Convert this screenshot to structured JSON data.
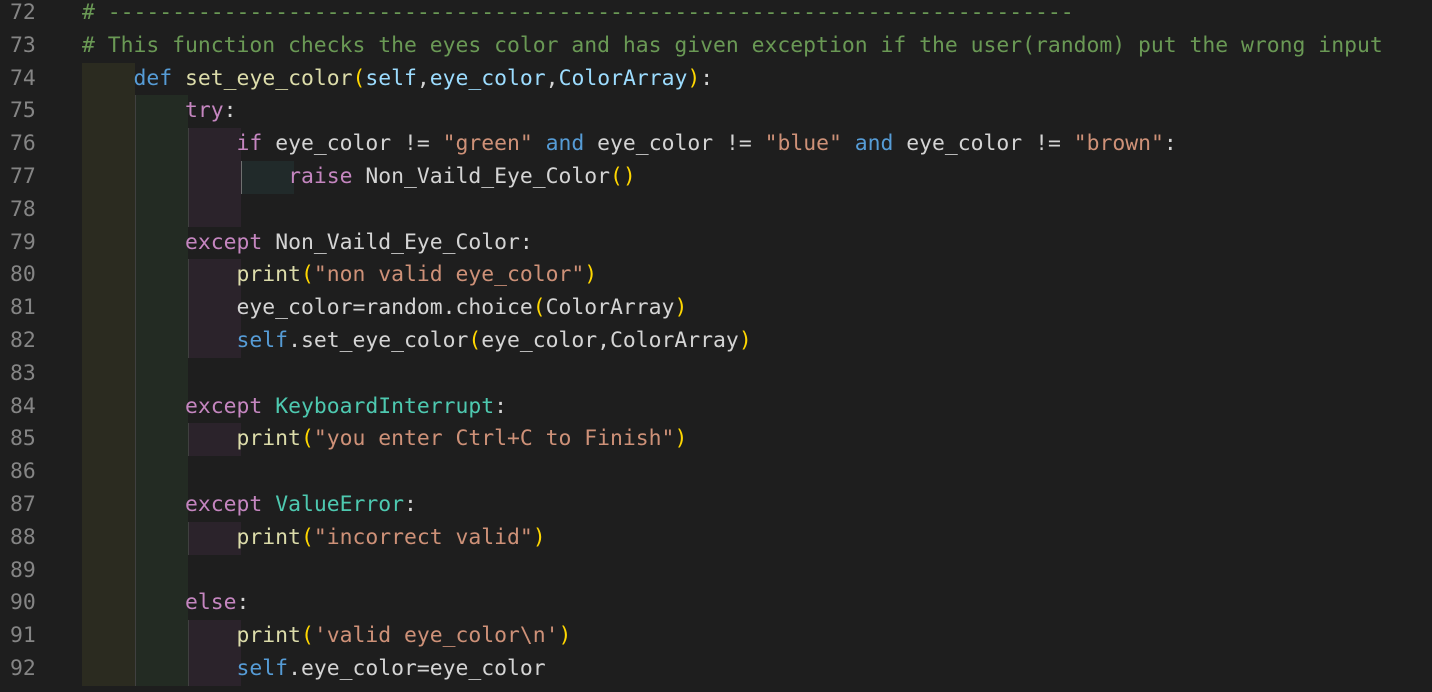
{
  "theme": {
    "background": "#1e1e1e",
    "line_number": "#858585",
    "comment": "#6a9955",
    "keyword": "#569cd6",
    "control": "#c586c0",
    "function": "#dcdcaa",
    "parameter": "#9cdcfe",
    "class": "#4ec9b0",
    "string": "#ce9178",
    "bracket_gold": "#ffd700",
    "bracket_orchid": "#da70d6"
  },
  "lines": [
    {
      "number": "72",
      "indent": 0,
      "tokens": [
        {
          "t": "# ---------------------------------------------------------------------------",
          "c": "comment"
        }
      ]
    },
    {
      "number": "73",
      "indent": 0,
      "tokens": [
        {
          "t": "# This function checks the eyes color and has given exception if the user(random) put the wrong input",
          "c": "comment"
        }
      ]
    },
    {
      "number": "74",
      "indent": 1,
      "tokens": [
        {
          "t": "    ",
          "c": "plain"
        },
        {
          "t": "def",
          "c": "kw"
        },
        {
          "t": " ",
          "c": "plain"
        },
        {
          "t": "set_eye_color",
          "c": "fn"
        },
        {
          "t": "(",
          "c": "b1"
        },
        {
          "t": "self",
          "c": "param"
        },
        {
          "t": ",",
          "c": "plain"
        },
        {
          "t": "eye_color",
          "c": "param"
        },
        {
          "t": ",",
          "c": "plain"
        },
        {
          "t": "ColorArray",
          "c": "param"
        },
        {
          "t": ")",
          "c": "b1"
        },
        {
          "t": ":",
          "c": "plain"
        }
      ]
    },
    {
      "number": "75",
      "indent": 2,
      "tokens": [
        {
          "t": "        ",
          "c": "plain"
        },
        {
          "t": "try",
          "c": "ctrl"
        },
        {
          "t": ":",
          "c": "plain"
        }
      ]
    },
    {
      "number": "76",
      "indent": 3,
      "tokens": [
        {
          "t": "            ",
          "c": "plain"
        },
        {
          "t": "if",
          "c": "ctrl"
        },
        {
          "t": " eye_color != ",
          "c": "plain"
        },
        {
          "t": "\"green\"",
          "c": "str"
        },
        {
          "t": " ",
          "c": "plain"
        },
        {
          "t": "and",
          "c": "kw"
        },
        {
          "t": " eye_color != ",
          "c": "plain"
        },
        {
          "t": "\"blue\"",
          "c": "str"
        },
        {
          "t": " ",
          "c": "plain"
        },
        {
          "t": "and",
          "c": "kw"
        },
        {
          "t": " eye_color != ",
          "c": "plain"
        },
        {
          "t": "\"brown\"",
          "c": "str"
        },
        {
          "t": ":",
          "c": "plain"
        }
      ]
    },
    {
      "number": "77",
      "indent": 4,
      "tokens": [
        {
          "t": "                ",
          "c": "plain"
        },
        {
          "t": "raise",
          "c": "ctrl"
        },
        {
          "t": " Non_Vaild_Eye_Color",
          "c": "plain"
        },
        {
          "t": "()",
          "c": "b1"
        }
      ]
    },
    {
      "number": "78",
      "indent": 3,
      "tokens": []
    },
    {
      "number": "79",
      "indent": 2,
      "tokens": [
        {
          "t": "        ",
          "c": "plain"
        },
        {
          "t": "except",
          "c": "ctrl"
        },
        {
          "t": " Non_Vaild_Eye_Color:",
          "c": "plain"
        }
      ]
    },
    {
      "number": "80",
      "indent": 3,
      "tokens": [
        {
          "t": "            ",
          "c": "plain"
        },
        {
          "t": "print",
          "c": "fn"
        },
        {
          "t": "(",
          "c": "b1"
        },
        {
          "t": "\"non valid eye_color\"",
          "c": "str"
        },
        {
          "t": ")",
          "c": "b1"
        }
      ]
    },
    {
      "number": "81",
      "indent": 3,
      "tokens": [
        {
          "t": "            ",
          "c": "plain"
        },
        {
          "t": "eye_color=random.choice",
          "c": "plain"
        },
        {
          "t": "(",
          "c": "b1"
        },
        {
          "t": "ColorArray",
          "c": "plain"
        },
        {
          "t": ")",
          "c": "b1"
        }
      ]
    },
    {
      "number": "82",
      "indent": 3,
      "tokens": [
        {
          "t": "            ",
          "c": "plain"
        },
        {
          "t": "self",
          "c": "kw"
        },
        {
          "t": ".set_eye_color",
          "c": "plain"
        },
        {
          "t": "(",
          "c": "b1"
        },
        {
          "t": "eye_color,ColorArray",
          "c": "plain"
        },
        {
          "t": ")",
          "c": "b1"
        }
      ]
    },
    {
      "number": "83",
      "indent": 2,
      "tokens": []
    },
    {
      "number": "84",
      "indent": 2,
      "tokens": [
        {
          "t": "        ",
          "c": "plain"
        },
        {
          "t": "except",
          "c": "ctrl"
        },
        {
          "t": " ",
          "c": "plain"
        },
        {
          "t": "KeyboardInterrupt",
          "c": "class"
        },
        {
          "t": ":",
          "c": "plain"
        }
      ]
    },
    {
      "number": "85",
      "indent": 3,
      "tokens": [
        {
          "t": "            ",
          "c": "plain"
        },
        {
          "t": "print",
          "c": "fn"
        },
        {
          "t": "(",
          "c": "b1"
        },
        {
          "t": "\"you enter Ctrl+C to Finish\"",
          "c": "str"
        },
        {
          "t": ")",
          "c": "b1"
        }
      ]
    },
    {
      "number": "86",
      "indent": 2,
      "tokens": []
    },
    {
      "number": "87",
      "indent": 2,
      "tokens": [
        {
          "t": "        ",
          "c": "plain"
        },
        {
          "t": "except",
          "c": "ctrl"
        },
        {
          "t": " ",
          "c": "plain"
        },
        {
          "t": "ValueError",
          "c": "class"
        },
        {
          "t": ":",
          "c": "plain"
        }
      ]
    },
    {
      "number": "88",
      "indent": 3,
      "tokens": [
        {
          "t": "            ",
          "c": "plain"
        },
        {
          "t": "print",
          "c": "fn"
        },
        {
          "t": "(",
          "c": "b1"
        },
        {
          "t": "\"incorrect valid\"",
          "c": "str"
        },
        {
          "t": ")",
          "c": "b1"
        }
      ]
    },
    {
      "number": "89",
      "indent": 2,
      "tokens": []
    },
    {
      "number": "90",
      "indent": 2,
      "tokens": [
        {
          "t": "        ",
          "c": "plain"
        },
        {
          "t": "else",
          "c": "ctrl"
        },
        {
          "t": ":",
          "c": "plain"
        }
      ]
    },
    {
      "number": "91",
      "indent": 3,
      "tokens": [
        {
          "t": "            ",
          "c": "plain"
        },
        {
          "t": "print",
          "c": "fn"
        },
        {
          "t": "(",
          "c": "b1"
        },
        {
          "t": "'valid eye_color\\n'",
          "c": "str"
        },
        {
          "t": ")",
          "c": "b1"
        }
      ]
    },
    {
      "number": "92",
      "indent": 3,
      "tokens": [
        {
          "t": "            ",
          "c": "plain"
        },
        {
          "t": "self",
          "c": "kw"
        },
        {
          "t": ".eye_color=eye_color",
          "c": "plain"
        }
      ]
    }
  ]
}
